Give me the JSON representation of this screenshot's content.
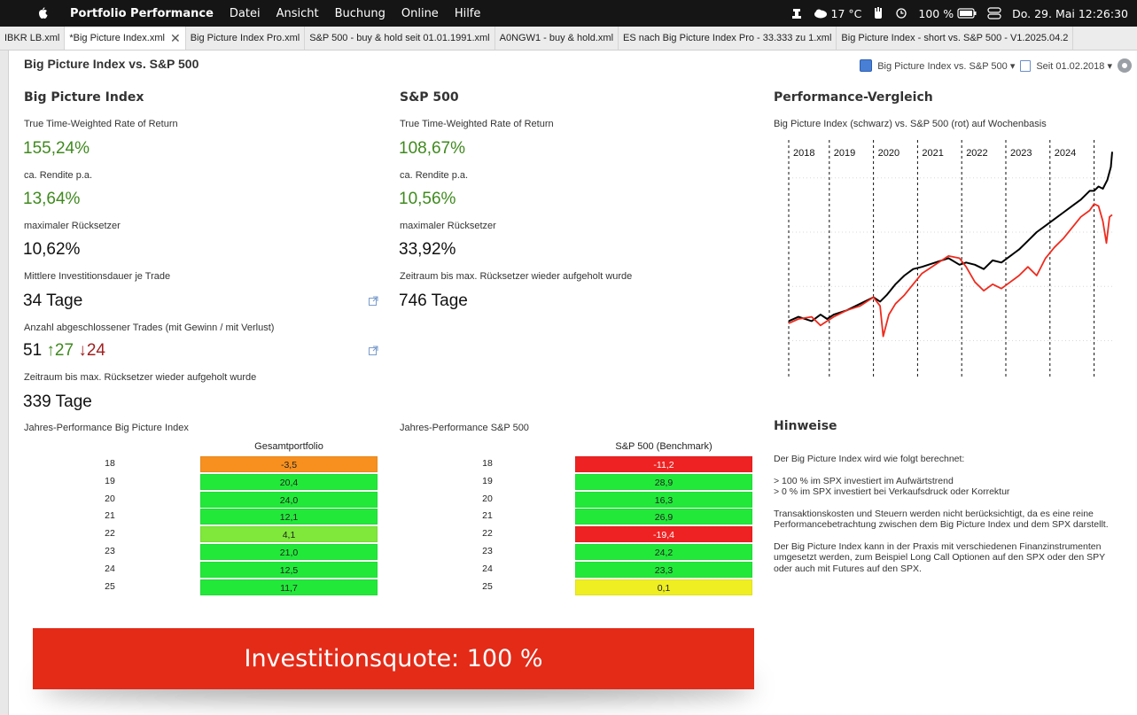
{
  "menubar": {
    "app_name": "Portfolio Performance",
    "menus": [
      "Datei",
      "Ansicht",
      "Buchung",
      "Online",
      "Hilfe"
    ],
    "weather": "17 °C",
    "battery": "100 %",
    "datetime": "Do. 29. Mai  12:26:30"
  },
  "tabs": [
    {
      "label": "IBKR LB.xml",
      "active": false
    },
    {
      "label": "*Big Picture Index.xml",
      "active": true
    },
    {
      "label": "Big Picture Index Pro.xml",
      "active": false
    },
    {
      "label": "S&P 500 - buy & hold seit 01.01.1991.xml",
      "active": false
    },
    {
      "label": "A0NGW1 - buy & hold.xml",
      "active": false
    },
    {
      "label": "ES nach Big Picture Index Pro - 33.333 zu 1.xml",
      "active": false
    },
    {
      "label": "Big Picture Index - short vs. S&P 500 - V1.2025.04.2",
      "active": false
    }
  ],
  "page_title": "Big Picture Index vs. S&P 500",
  "view_bar": {
    "view_name": "Big Picture Index vs. S&P 500",
    "period": "Seit 01.02.2018"
  },
  "left_col": {
    "heading": "Big Picture Index",
    "ttwror_label": "True Time-Weighted Rate of Return",
    "ttwror_value": "155,24%",
    "rendite_label": "ca. Rendite p.a.",
    "rendite_value": "13,64%",
    "drawdown_label": "maximaler Rücksetzer",
    "drawdown_value": "10,62%",
    "duration_label": "Mittlere Investitionsdauer je Trade",
    "duration_value": "34 Tage",
    "trades_label": "Anzahl abgeschlossener Trades (mit Gewinn / mit Verlust)",
    "trades_total": "51",
    "trades_win": "↑27",
    "trades_loss": "↓24",
    "recovery_label": "Zeitraum bis max. Rücksetzer wieder aufgeholt wurde",
    "recovery_value": "339 Tage"
  },
  "mid_col": {
    "heading": "S&P 500",
    "ttwror_label": "True Time-Weighted Rate of Return",
    "ttwror_value": "108,67%",
    "rendite_label": "ca. Rendite p.a.",
    "rendite_value": "10,56%",
    "drawdown_label": "maximaler Rücksetzer",
    "drawdown_value": "33,92%",
    "recovery_label": "Zeitraum bis max. Rücksetzer wieder aufgeholt wurde",
    "recovery_value": "746 Tage"
  },
  "table_left": {
    "title": "Jahres-Performance Big Picture Index",
    "header": "Gesamtportfolio",
    "rows": [
      {
        "year": "18",
        "value": "-3,5",
        "color": "#f7901e"
      },
      {
        "year": "19",
        "value": "20,4",
        "color": "#22e83a"
      },
      {
        "year": "20",
        "value": "24,0",
        "color": "#22e83a"
      },
      {
        "year": "21",
        "value": "12,1",
        "color": "#22e83a"
      },
      {
        "year": "22",
        "value": "4,1",
        "color": "#7fe83a"
      },
      {
        "year": "23",
        "value": "21,0",
        "color": "#22e83a"
      },
      {
        "year": "24",
        "value": "12,5",
        "color": "#22e83a"
      },
      {
        "year": "25",
        "value": "11,7",
        "color": "#22e83a"
      }
    ]
  },
  "table_mid": {
    "title": "Jahres-Performance S&P 500",
    "header": "S&P 500 (Benchmark)",
    "rows": [
      {
        "year": "18",
        "value": "-11,2",
        "color": "#ee2222"
      },
      {
        "year": "19",
        "value": "28,9",
        "color": "#22e83a"
      },
      {
        "year": "20",
        "value": "16,3",
        "color": "#22e83a"
      },
      {
        "year": "21",
        "value": "26,9",
        "color": "#22e83a"
      },
      {
        "year": "22",
        "value": "-19,4",
        "color": "#ee2222"
      },
      {
        "year": "23",
        "value": "24,2",
        "color": "#22e83a"
      },
      {
        "year": "24",
        "value": "23,3",
        "color": "#22e83a"
      },
      {
        "year": "25",
        "value": "0,1",
        "color": "#eeee22"
      }
    ]
  },
  "chart_section": {
    "heading": "Performance-Vergleich",
    "subtitle": "Big Picture Index (schwarz) vs. S&P 500 (rot) auf Wochenbasis"
  },
  "chart_data": {
    "type": "line",
    "year_labels": [
      "2018",
      "2019",
      "2020",
      "2021",
      "2022",
      "2023",
      "2024"
    ],
    "x_start": 2018.08,
    "x_end": 2025.41,
    "ylim": [
      0,
      1
    ],
    "grid": true,
    "series": [
      {
        "color": "#000000",
        "x": [
          2018.08,
          2018.3,
          2018.6,
          2018.8,
          2018.95,
          2019.1,
          2019.4,
          2019.7,
          2020.0,
          2020.15,
          2020.3,
          2020.5,
          2020.7,
          2020.9,
          2021.1,
          2021.4,
          2021.7,
          2021.95,
          2022.1,
          2022.3,
          2022.5,
          2022.7,
          2022.9,
          2023.1,
          2023.3,
          2023.5,
          2023.7,
          2023.9,
          2024.1,
          2024.3,
          2024.5,
          2024.7,
          2024.9,
          2025.0,
          2025.1,
          2025.2,
          2025.3,
          2025.38,
          2025.41
        ],
        "y": [
          0.19,
          0.21,
          0.19,
          0.22,
          0.2,
          0.22,
          0.24,
          0.27,
          0.3,
          0.28,
          0.31,
          0.36,
          0.4,
          0.43,
          0.44,
          0.46,
          0.48,
          0.45,
          0.46,
          0.45,
          0.43,
          0.47,
          0.46,
          0.49,
          0.52,
          0.56,
          0.6,
          0.63,
          0.66,
          0.69,
          0.72,
          0.75,
          0.79,
          0.79,
          0.81,
          0.8,
          0.84,
          0.9,
          0.97
        ]
      },
      {
        "color": "#ee2b1e",
        "x": [
          2018.08,
          2018.3,
          2018.6,
          2018.8,
          2018.95,
          2019.1,
          2019.4,
          2019.7,
          2020.0,
          2020.15,
          2020.22,
          2020.35,
          2020.5,
          2020.7,
          2020.9,
          2021.1,
          2021.4,
          2021.7,
          2021.95,
          2022.1,
          2022.3,
          2022.5,
          2022.7,
          2022.9,
          2023.1,
          2023.3,
          2023.5,
          2023.7,
          2023.9,
          2024.1,
          2024.3,
          2024.5,
          2024.7,
          2024.9,
          2025.0,
          2025.1,
          2025.2,
          2025.28,
          2025.35,
          2025.41
        ],
        "y": [
          0.18,
          0.2,
          0.21,
          0.17,
          0.19,
          0.21,
          0.24,
          0.26,
          0.3,
          0.26,
          0.12,
          0.22,
          0.27,
          0.31,
          0.36,
          0.41,
          0.45,
          0.49,
          0.48,
          0.44,
          0.37,
          0.33,
          0.36,
          0.34,
          0.37,
          0.4,
          0.44,
          0.4,
          0.48,
          0.53,
          0.57,
          0.62,
          0.67,
          0.7,
          0.73,
          0.72,
          0.65,
          0.55,
          0.67,
          0.68
        ]
      }
    ]
  },
  "notes": {
    "heading": "Hinweise",
    "p1": "Der Big Picture Index wird wie folgt berechnet:",
    "p2a": "> 100 % im SPX investiert im Aufwärtstrend",
    "p2b": "> 0 % im SPX investiert bei Verkaufsdruck oder Korrektur",
    "p3": "Transaktionskosten und Steuern werden nicht berücksichtigt, da es eine reine Performancebetrachtung zwischen dem Big Picture Index und dem SPX darstellt.",
    "p4": "Der Big Picture Index kann in der Praxis mit verschiedenen Finanzinstrumenten umgesetzt werden, zum Beispiel Long Call Optionen auf den SPX oder den SPY oder auch mit Futures auf den SPX."
  },
  "banner": {
    "text": "Investitionsquote: 100 %",
    "color": "#e32b18"
  }
}
